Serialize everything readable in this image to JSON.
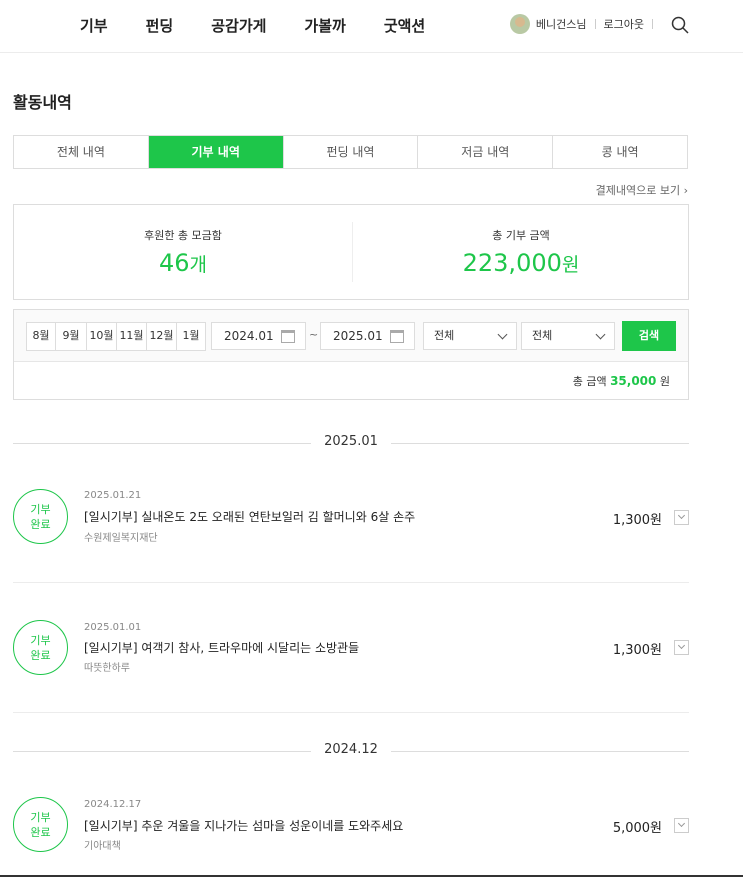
{
  "nav": {
    "menu": [
      "기부",
      "펀딩",
      "공감가게",
      "가볼까",
      "굿액션"
    ],
    "user_name": "베니건스님",
    "logout": "로그아웃"
  },
  "page": {
    "title": "활동내역",
    "tabs": [
      {
        "label": "전체 내역",
        "active": false
      },
      {
        "label": "기부 내역",
        "active": true
      },
      {
        "label": "펀딩 내역",
        "active": false
      },
      {
        "label": "저금 내역",
        "active": false
      },
      {
        "label": "콩 내역",
        "active": false
      }
    ],
    "payment_link": "결제내역으로 보기"
  },
  "summary": {
    "total_count_label": "후원한 총 모금함",
    "total_count_value": "46",
    "total_count_unit": "개",
    "total_amount_label": "총 기부 금액",
    "total_amount_value": "223,000",
    "total_amount_unit": "원"
  },
  "filter": {
    "months": [
      "8월",
      "9월",
      "10월",
      "11월",
      "12월",
      "1월"
    ],
    "date_from": "2024.01",
    "date_to": "2025.01",
    "tilde": "~",
    "select1": "전체",
    "select2": "전체",
    "search_label": "검색",
    "total_label": "총 금액",
    "total_value": "35,000",
    "total_unit": "원"
  },
  "groups": [
    {
      "month": "2025.01",
      "entries": [
        {
          "badge_line1": "기부",
          "badge_line2": "완료",
          "date": "2025.01.21",
          "title": "[일시기부] 실내온도 2도 오래된 연탄보일러 김 할머니와 6살 손주",
          "org": "수원제일복지재단",
          "amount": "1,300원"
        },
        {
          "badge_line1": "기부",
          "badge_line2": "완료",
          "date": "2025.01.01",
          "title": "[일시기부] 여객기 참사, 트라우마에 시달리는 소방관들",
          "org": "따뜻한하루",
          "amount": "1,300원"
        }
      ]
    },
    {
      "month": "2024.12",
      "entries": [
        {
          "badge_line1": "기부",
          "badge_line2": "완료",
          "date": "2024.12.17",
          "title": "[일시기부] 추운 겨울을 지나가는 섬마을 성운이네를 도와주세요",
          "org": "기아대책",
          "amount": "5,000원"
        }
      ]
    }
  ]
}
